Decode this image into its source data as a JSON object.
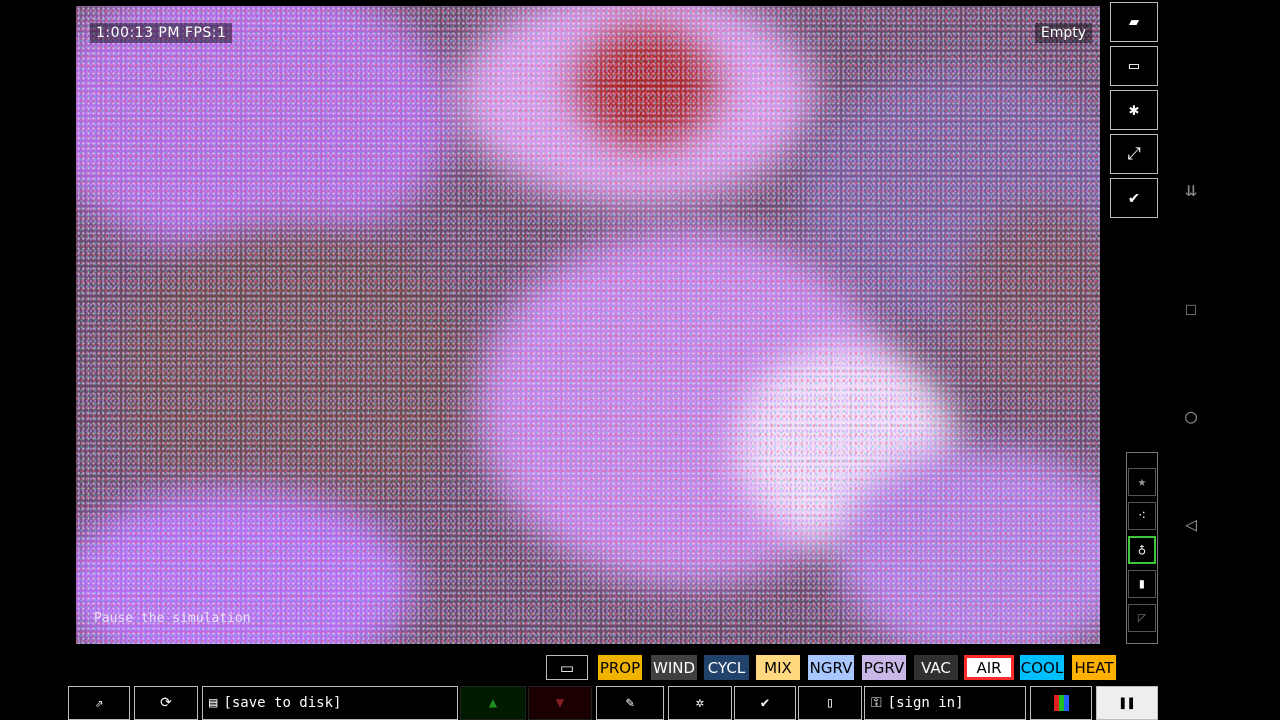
{
  "hud": {
    "time_fps": "1:00:13 PM  FPS:1",
    "status": "Empty",
    "tooltip": "Pause the simulation"
  },
  "right_tools": [
    {
      "name": "eraser-icon",
      "glyph": "▰"
    },
    {
      "name": "console-icon",
      "glyph": "▭"
    },
    {
      "name": "settings-icon",
      "glyph": "✱"
    },
    {
      "name": "line-tool-icon",
      "glyph": "⤢"
    },
    {
      "name": "check-tool-icon",
      "glyph": "✔"
    }
  ],
  "right_small": [
    {
      "name": "favorites-icon",
      "glyph": "★"
    },
    {
      "name": "particles-icon",
      "glyph": "⁖"
    },
    {
      "name": "tool-icon",
      "glyph": "♁"
    },
    {
      "name": "bookmark-icon",
      "glyph": "▮"
    },
    {
      "name": "decor-icon",
      "glyph": "◸"
    }
  ],
  "modes": [
    {
      "label": "PROP",
      "bg": "#f0b400",
      "fg": "#000"
    },
    {
      "label": "WIND",
      "bg": "#404040",
      "fg": "#fff"
    },
    {
      "label": "CYCL",
      "bg": "#21426b",
      "fg": "#fff"
    },
    {
      "label": "MIX",
      "bg": "#ffd880",
      "fg": "#000"
    },
    {
      "label": "NGRV",
      "bg": "#a9c7ff",
      "fg": "#000"
    },
    {
      "label": "PGRV",
      "bg": "#c8b8e8",
      "fg": "#000"
    },
    {
      "label": "VAC",
      "bg": "#303030",
      "fg": "#fff"
    },
    {
      "label": "AIR",
      "bg": "#ffffff",
      "fg": "#000"
    },
    {
      "label": "COOL",
      "bg": "#00bfff",
      "fg": "#000"
    },
    {
      "label": "HEAT",
      "bg": "#ffb000",
      "fg": "#000"
    }
  ],
  "bottom": {
    "open_glyph": "⇗",
    "reload_glyph": "⟳",
    "save_label": "[save to disk]",
    "upvote_glyph": "▲",
    "downvote_glyph": "▼",
    "tag_glyph": "✎",
    "bug_glyph": "✲",
    "check_glyph": "✔",
    "new_glyph": "▯",
    "sign_in_label": "[sign in]",
    "render_glyph": "▮▮▮",
    "pause_glyph": "❚❚"
  },
  "colors": {
    "accent_selected": "#ff2a2a",
    "selected_tool_border": "#3cc83c"
  }
}
